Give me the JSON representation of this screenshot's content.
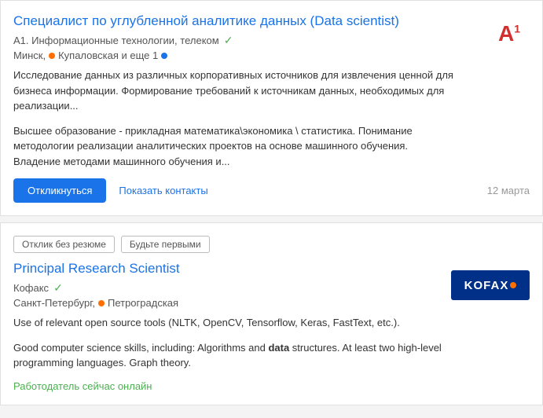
{
  "card1": {
    "title": "Специалист по углубленной аналитике данных (Data scientist)",
    "company": "А1. Информационные технологии, телеком",
    "location_city": "Минск,",
    "location_metro": "Купаловская и еще 1",
    "description1": "Исследование данных из различных корпоративных источников для извлечения ценной для бизнеса информации. Формирование требований к источникам данных, необходимых для реализации...",
    "description2": "Высшее образование - прикладная математика\\экономика \\ статистика. Понимание методологии реализации аналитических проектов на основе машинного обучения. Владение методами машинного обучения и...",
    "btn_apply": "Откликнуться",
    "btn_contacts": "Показать контакты",
    "date": "12 марта",
    "logo_text": "А",
    "logo_sup": "1"
  },
  "card2": {
    "tag1": "Отклик без резюме",
    "tag2": "Будьте первыми",
    "title": "Principal Research Scientist",
    "company": "Кофакс",
    "location_city": "Санкт-Петербург,",
    "location_metro": "Петроградская",
    "description1": "Use of relevant open source tools (NLTK, OpenCV, Tensorflow, Keras, FastText, etc.).",
    "description2": "Good computer science skills, including: Algorithms and ",
    "description2_bold": "data",
    "description2_end": " structures. At least two high-level programming languages. Graph theory.",
    "employer_online": "Работодатель сейчас онлайн",
    "logo_text": "KOFAX"
  }
}
